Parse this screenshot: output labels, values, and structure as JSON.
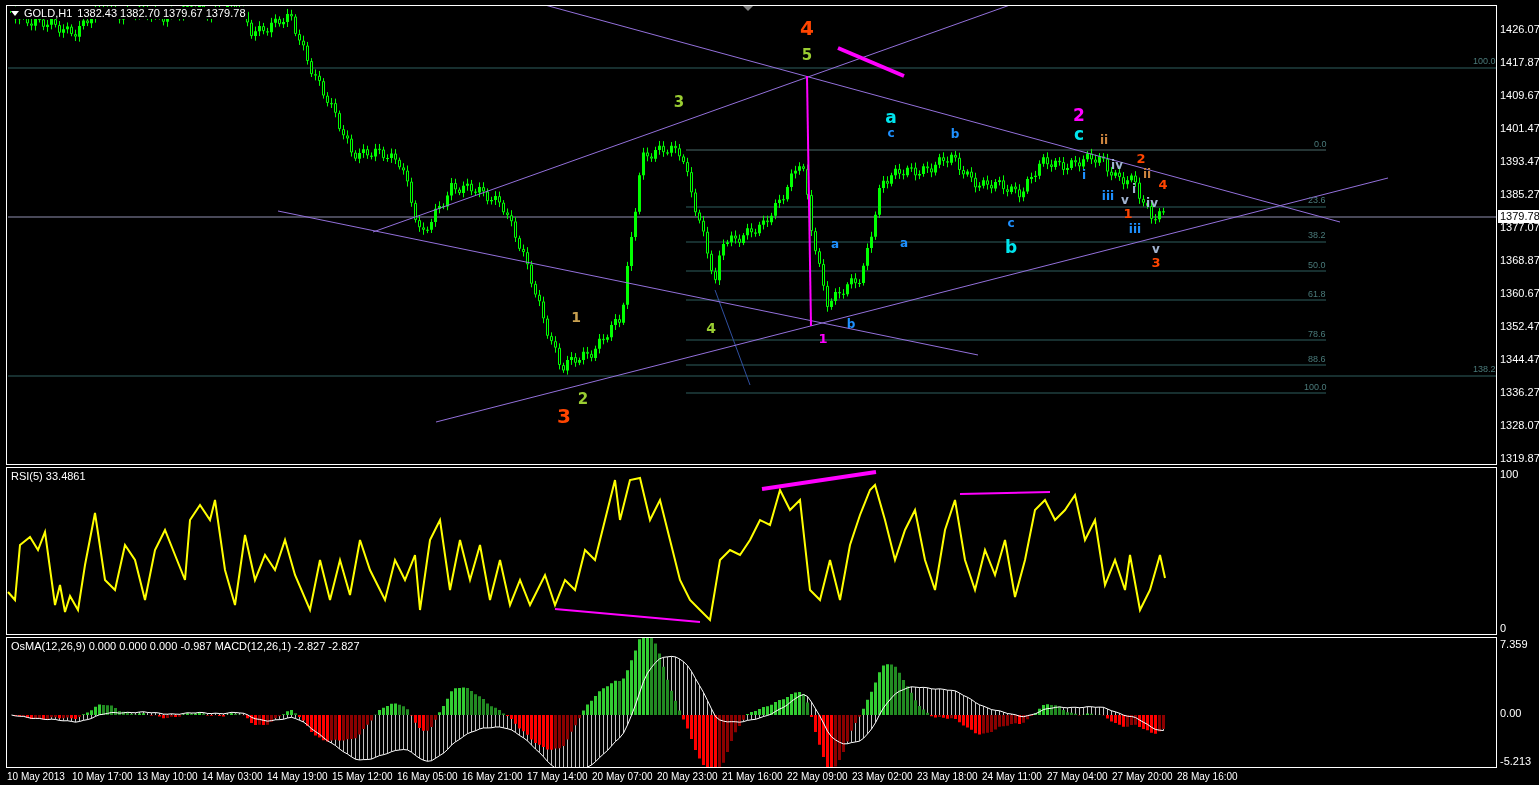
{
  "chart_header": {
    "symbol": "GOLD,H1",
    "ohlc": "1382.43 1382.70 1379.67 1379.78"
  },
  "main_pane": {
    "price_axis": [
      "1426.07",
      "1417.87",
      "1409.67",
      "1401.47",
      "1393.47",
      "1385.27",
      "1377.07",
      "1368.87",
      "1360.67",
      "1352.47",
      "1344.47",
      "1336.27",
      "1328.07",
      "1319.87"
    ],
    "current_price": "1379.78",
    "fib_labels": [
      "100.0",
      "0.0",
      "23.6",
      "38.2",
      "50.0",
      "61.8",
      "78.6",
      "88.6",
      "100.0",
      "138.2"
    ],
    "wave_labels": [
      {
        "text": "3",
        "color": "#ff4500"
      },
      {
        "text": "1",
        "color": "#c8a050"
      },
      {
        "text": "2",
        "color": "#9acd32"
      },
      {
        "text": "3",
        "color": "#9acd32"
      },
      {
        "text": "4",
        "color": "#9acd32"
      },
      {
        "text": "4",
        "color": "#ff4500"
      },
      {
        "text": "5",
        "color": "#9acd32"
      },
      {
        "text": "1",
        "color": "#ff00ff"
      },
      {
        "text": "a",
        "color": "#1e90ff"
      },
      {
        "text": "b",
        "color": "#1e90ff"
      },
      {
        "text": "a",
        "color": "#00e5ee"
      },
      {
        "text": "c",
        "color": "#1e90ff"
      },
      {
        "text": "a",
        "color": "#1e90ff"
      },
      {
        "text": "b",
        "color": "#1e90ff"
      },
      {
        "text": "c",
        "color": "#1e90ff"
      },
      {
        "text": "b",
        "color": "#00e5ee"
      },
      {
        "text": "2",
        "color": "#ff00ff"
      },
      {
        "text": "c",
        "color": "#00e5ee"
      },
      {
        "text": "i",
        "color": "#1e90ff"
      },
      {
        "text": "ii",
        "color": "#cd853f"
      },
      {
        "text": "iii",
        "color": "#1e90ff"
      },
      {
        "text": "iv",
        "color": "#a0b4d0"
      },
      {
        "text": "v",
        "color": "#a0b4d0"
      },
      {
        "text": "1",
        "color": "#ff4500"
      },
      {
        "text": "i",
        "color": "#a0b4d0"
      },
      {
        "text": "2",
        "color": "#ff4500"
      },
      {
        "text": "iii",
        "color": "#1e90ff"
      },
      {
        "text": "ii",
        "color": "#cd853f"
      },
      {
        "text": "iv",
        "color": "#a0b4d0"
      },
      {
        "text": "v",
        "color": "#a0b4d0"
      },
      {
        "text": "3",
        "color": "#ff4500"
      },
      {
        "text": "4",
        "color": "#ff4500"
      }
    ]
  },
  "rsi_pane": {
    "title": "RSI(5) 33.4861",
    "axis": [
      "100",
      "0"
    ]
  },
  "macd_pane": {
    "title": "OsMA(12,26,9) 0.000 0.000 0.000 -0.987  MACD(12,26,1) -2.827 -2.827",
    "axis": [
      "7.359",
      "0.00",
      "-5.213"
    ]
  },
  "time_axis": [
    "10 May 2013",
    "10 May 17:00",
    "13 May 10:00",
    "14 May 03:00",
    "14 May 19:00",
    "15 May 12:00",
    "16 May 05:00",
    "16 May 21:00",
    "17 May 14:00",
    "20 May 07:00",
    "20 May 23:00",
    "21 May 16:00",
    "22 May 09:00",
    "23 May 02:00",
    "23 May 18:00",
    "24 May 11:00",
    "27 May 04:00",
    "27 May 20:00",
    "28 May 16:00"
  ]
}
